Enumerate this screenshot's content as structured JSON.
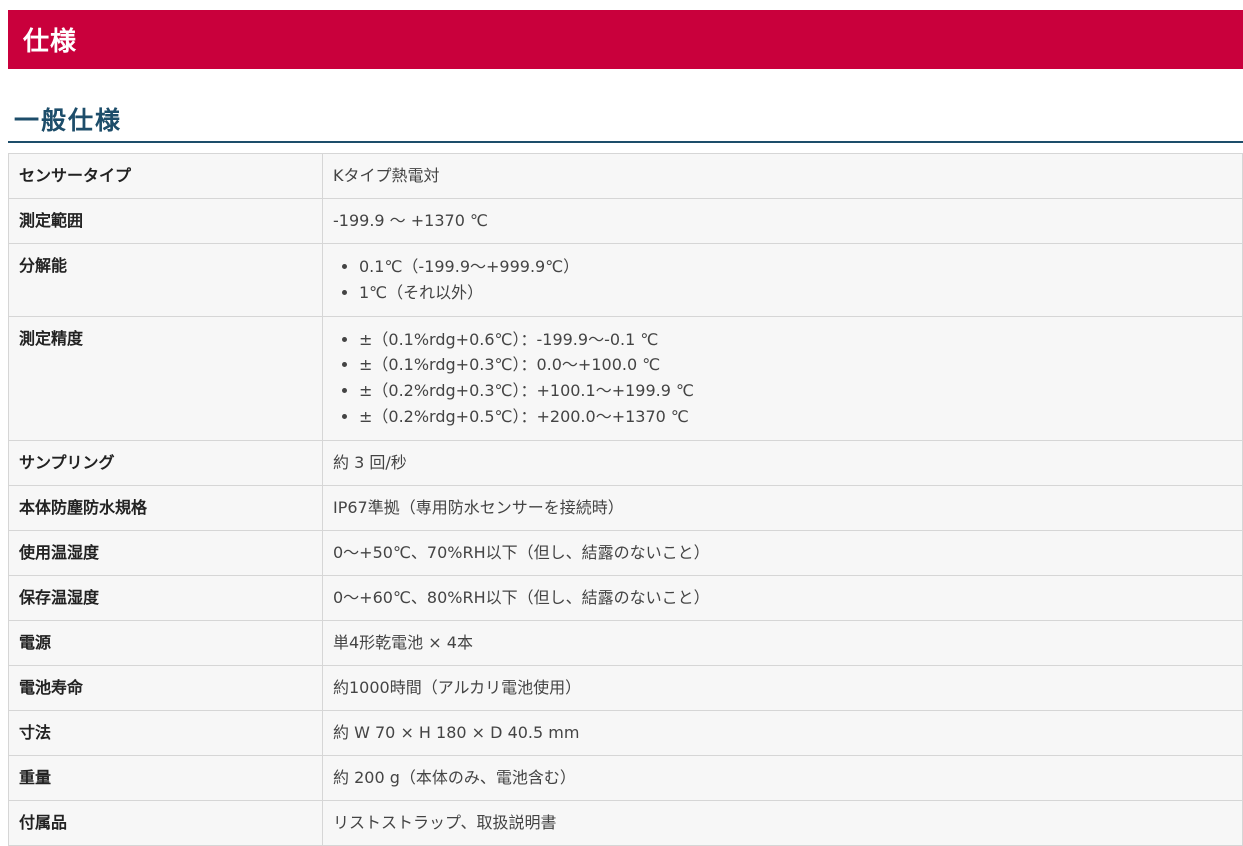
{
  "header": {
    "title": "仕様"
  },
  "section": {
    "title": "一般仕様"
  },
  "specs": {
    "sensor_type": {
      "label": "センサータイプ",
      "value": "Kタイプ熱電対"
    },
    "measurement_range": {
      "label": "測定範囲",
      "value": "-199.9 ～ +1370 ℃"
    },
    "resolution": {
      "label": "分解能",
      "items": [
        "0.1℃（-199.9～+999.9℃）",
        "1℃（それ以外）"
      ]
    },
    "accuracy": {
      "label": "測定精度",
      "items": [
        "±（0.1%rdg+0.6℃）：-199.9～-0.1 ℃",
        "±（0.1%rdg+0.3℃）：0.0～+100.0 ℃",
        "±（0.2%rdg+0.3℃）：+100.1～+199.9 ℃",
        "±（0.2%rdg+0.5℃）：+200.0～+1370 ℃"
      ]
    },
    "sampling": {
      "label": "サンプリング",
      "value": "約 3 回/秒"
    },
    "waterproof": {
      "label": "本体防塵防水規格",
      "value": "IP67準拠（専用防水センサーを接続時）"
    },
    "operating_env": {
      "label": "使用温湿度",
      "value": "0～+50℃、70%RH以下（但し、結露のないこと）"
    },
    "storage_env": {
      "label": "保存温湿度",
      "value": "0～+60℃、80%RH以下（但し、結露のないこと）"
    },
    "power": {
      "label": "電源",
      "value": "単4形乾電池 × 4本"
    },
    "battery_life": {
      "label": "電池寿命",
      "value": "約1000時間（アルカリ電池使用）"
    },
    "dimensions": {
      "label": "寸法",
      "value": "約 W 70 × H 180 × D 40.5 mm"
    },
    "weight": {
      "label": "重量",
      "value": "約 200 g（本体のみ、電池含む）"
    },
    "accessories": {
      "label": "付属品",
      "value": "リストストラップ、取扱説明書"
    }
  },
  "colors": {
    "header_bg": "#c9003c",
    "section_title": "#1d4d6a",
    "table_bg": "#f7f7f7",
    "border": "#d6d6d6"
  }
}
